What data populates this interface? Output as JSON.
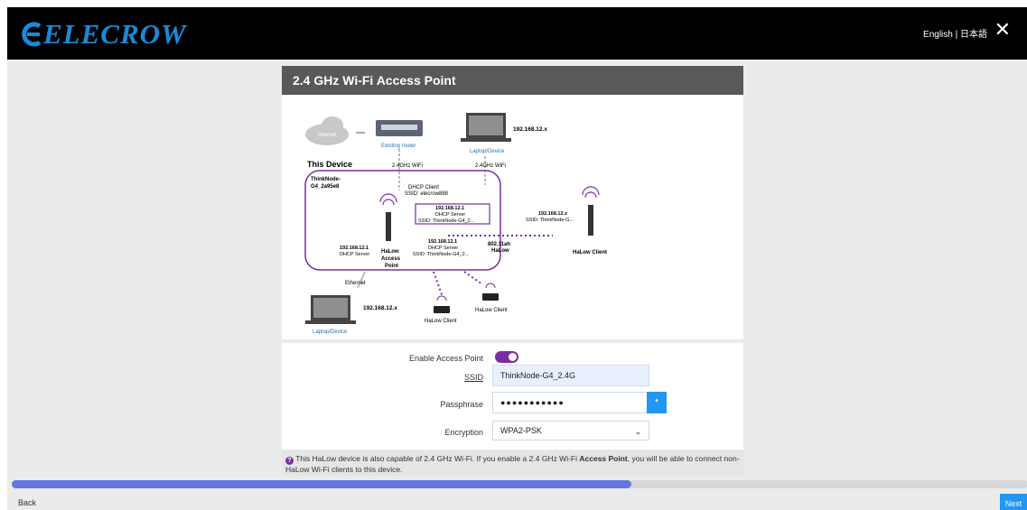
{
  "header": {
    "logo_text": "ELECROW",
    "language": "English | 日本語",
    "close_icon": "close-icon"
  },
  "card": {
    "title": "2.4 GHz Wi-Fi Access Point"
  },
  "diagram": {
    "internet": "Internet",
    "existing_router": "Existing router",
    "laptop_top_ip": "192.168.12.x",
    "laptop_top_label": "Laptop/Device",
    "this_device": "This Device",
    "wifi_left": "2.4GHz WiFi",
    "wifi_right": "2.4GHz WiFi",
    "device_name_1": "ThinkNode-",
    "device_name_2": "G4_2a95e8",
    "dhcp_client": "DHCP Client",
    "ssid_elecrow": "SSID: elecrow888",
    "inner_ip": "192.168.12.1",
    "inner_dhcp": "DHCP Server",
    "inner_ssid": "SSID: ThinkNode-G4_2...",
    "right_ip": "192.168.12.x",
    "right_ssid": "SSID: ThinkNode-G...",
    "left_ip": "192.168.12.1",
    "left_dhcp": "DHCP Server",
    "halow_ap_1": "HaLow",
    "halow_ap_2": "Access",
    "halow_ap_3": "Point",
    "mid_ip": "192.168.12.1",
    "mid_dhcp": "DHCP Server",
    "mid_ssid": "SSID: ThinkNode-G4_2...",
    "ah_1": "802.11ah",
    "ah_2": "HaLow",
    "halow_client_right": "HaLow Client",
    "ethernet": "Ethernet",
    "laptop_bottom_ip": "192.168.12.x",
    "laptop_bottom_label": "Laptop/Device",
    "halow_client_1": "HaLow Client",
    "halow_client_2": "HaLow Client"
  },
  "form": {
    "enable_label": "Enable Access Point",
    "enable_value": true,
    "ssid_label": "SSID",
    "ssid_value": "ThinkNode-G4_2.4G",
    "pass_label": "Passphrase",
    "pass_value": "●●●●●●●●●●●",
    "enc_label": "Encryption",
    "enc_value": "WPA2-PSK"
  },
  "note": {
    "text_before": "This HaLow device is also capable of 2.4 GHz Wi-Fi. If you enable a 2.4 GHz Wi-Fi ",
    "text_bold": "Access Point",
    "text_after": ", you will be able to connect non-HaLow Wi-Fi clients to this device."
  },
  "progress": {
    "percent": 61
  },
  "footer": {
    "back_label": "Back",
    "next_label": "Next"
  },
  "colors": {
    "accent": "#7a2ea0",
    "primary": "#2196f3",
    "progress": "#6476e0"
  }
}
